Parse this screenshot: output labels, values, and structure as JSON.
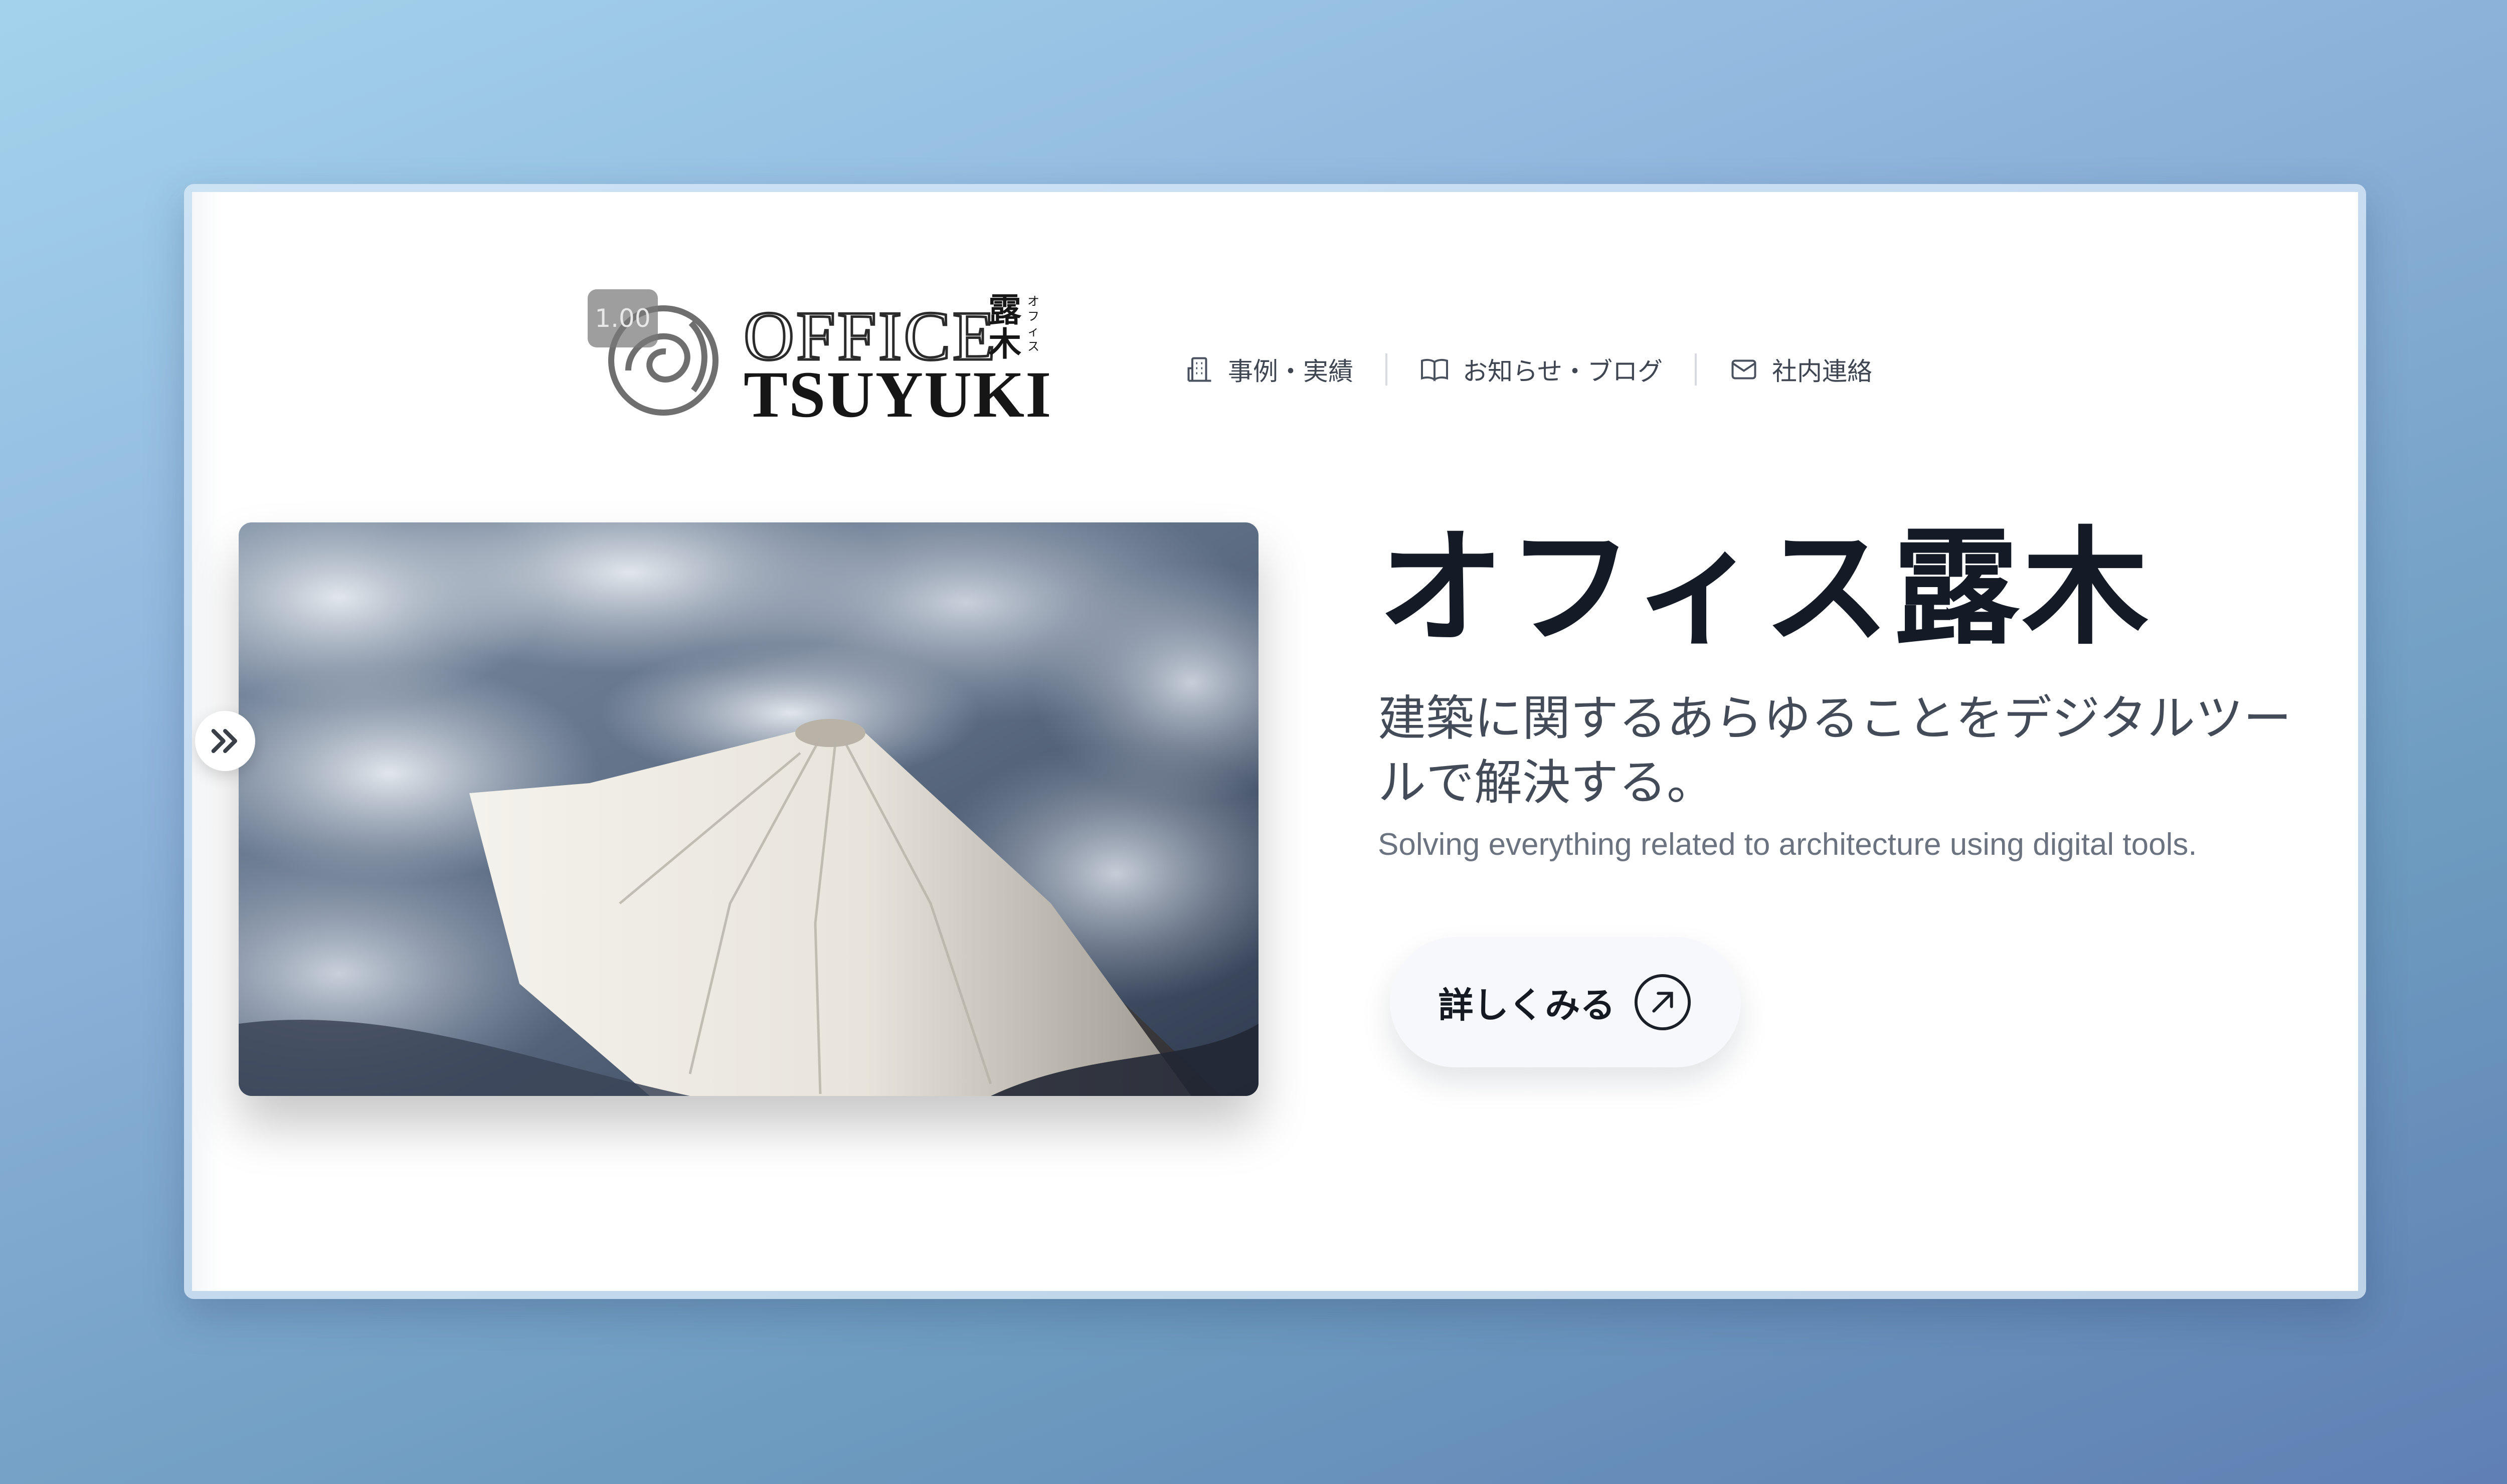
{
  "header": {
    "zoom_badge": "1.00",
    "logo": {
      "text_main": "OFFICE",
      "text_sub": "TSUYUKI",
      "kanji": "露木",
      "kana": "オフィス"
    },
    "nav": [
      {
        "label": "事例・実績",
        "icon": "building-icon"
      },
      {
        "label": "お知らせ・ブログ",
        "icon": "book-icon"
      },
      {
        "label": "社内連絡",
        "icon": "mail-icon"
      }
    ]
  },
  "hero": {
    "image": "mount-fuji-aerial-photo",
    "title": "オフィス露木",
    "subtitle": "建築に関するあらゆることをデジタルツールで解決する。",
    "english": "Solving everything related to architecture using digital tools.",
    "cta_label": "詳しくみる",
    "cta_icon": "arrow-up-right-icon"
  },
  "sidebar_toggle": {
    "icon": "double-chevron-right-icon"
  },
  "colors": {
    "title": "#141b26",
    "nav_text": "#3f4652",
    "background_top": "#a3d3ec",
    "background_bottom": "#5f7fb3"
  }
}
